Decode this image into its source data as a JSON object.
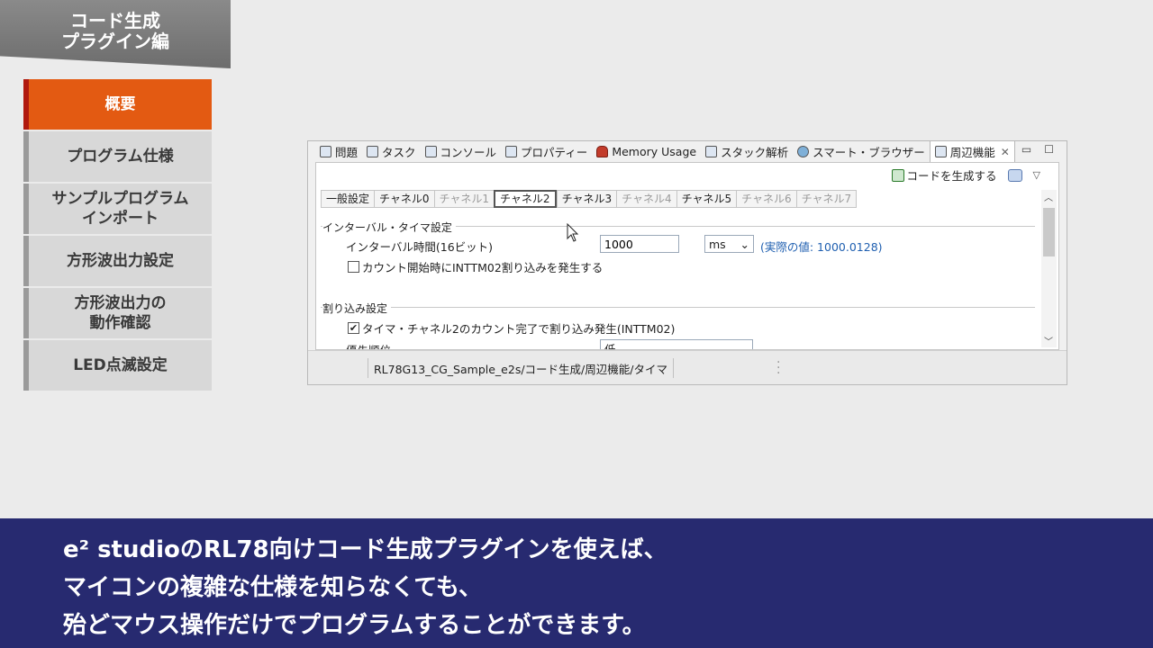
{
  "header": {
    "title_line1": "コード生成",
    "title_line2": "プラグイン編"
  },
  "chapters": [
    {
      "label": "概要",
      "active": true
    },
    {
      "label": "プログラム仕様",
      "active": false
    },
    {
      "label": "サンプルプログラム\nインポート",
      "active": false
    },
    {
      "label": "方形波出力設定",
      "active": false
    },
    {
      "label": "方形波出力の\n動作確認",
      "active": false
    },
    {
      "label": "LED点滅設定",
      "active": false
    }
  ],
  "ide": {
    "view_tabs": [
      {
        "label": "問題",
        "icon": "problems-icon"
      },
      {
        "label": "タスク",
        "icon": "tasks-icon"
      },
      {
        "label": "コンソール",
        "icon": "console-icon"
      },
      {
        "label": "プロパティー",
        "icon": "properties-icon"
      },
      {
        "label": "Memory Usage",
        "icon": "memory-usage-icon"
      },
      {
        "label": "スタック解析",
        "icon": "stack-analysis-icon"
      },
      {
        "label": "スマート・ブラウザー",
        "icon": "smart-browser-icon"
      },
      {
        "label": "周辺機能",
        "icon": "peripheral-icon",
        "active": true
      }
    ],
    "toolbar": {
      "generate_label": "コードを生成する"
    },
    "sub_tabs": [
      {
        "label": "一般設定",
        "state": "normal"
      },
      {
        "label": "チャネル0",
        "state": "normal"
      },
      {
        "label": "チャネル1",
        "state": "disabled"
      },
      {
        "label": "チャネル2",
        "state": "active"
      },
      {
        "label": "チャネル3",
        "state": "normal"
      },
      {
        "label": "チャネル4",
        "state": "disabled"
      },
      {
        "label": "チャネル5",
        "state": "normal"
      },
      {
        "label": "チャネル6",
        "state": "disabled"
      },
      {
        "label": "チャネル7",
        "state": "disabled"
      }
    ],
    "interval_group": {
      "title": "インターバル・タイマ設定",
      "interval_label": "インターバル時間(16ビット)",
      "interval_value": "1000",
      "unit_value": "ms",
      "actual_value": "(実際の値: 1000.0128)",
      "start_interrupt_label": "カウント開始時にINTTM02割り込みを発生する",
      "start_interrupt_checked": false
    },
    "interrupt_group": {
      "title": "割り込み設定",
      "complete_interrupt_label": "タイマ・チャネル2のカウント完了で割り込み発生(INTTM02)",
      "complete_interrupt_checked": true,
      "priority_label": "優先順位",
      "priority_value": "低"
    },
    "status_path": "RL78G13_CG_Sample_e2s/コード生成/周辺機能/タイマ"
  },
  "subtitle": {
    "line1": "e² studioのRL78向けコード生成プラグインを使えば、",
    "line2": "マイコンの複雑な仕様を知らなくても、",
    "line3": "殆どマウス操作だけでプログラムすることができます。"
  }
}
